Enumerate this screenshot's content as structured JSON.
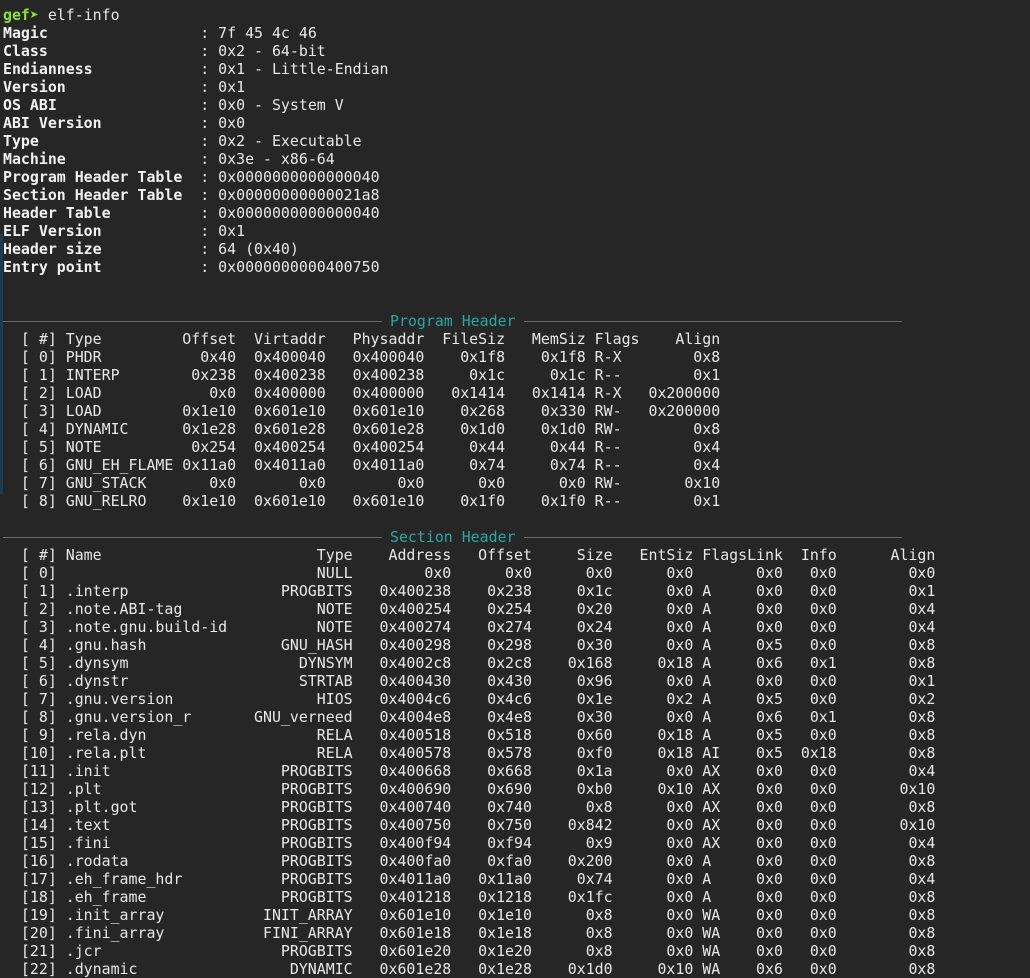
{
  "prompt": {
    "symbol": "gef➤",
    "command": "elf-info"
  },
  "elf_header": [
    {
      "key": "Magic",
      "value": "7f 45 4c 46"
    },
    {
      "key": "Class",
      "value": "0x2 - 64-bit"
    },
    {
      "key": "Endianness",
      "value": "0x1 - Little-Endian"
    },
    {
      "key": "Version",
      "value": "0x1"
    },
    {
      "key": "OS ABI",
      "value": "0x0 - System V"
    },
    {
      "key": "ABI Version",
      "value": "0x0"
    },
    {
      "key": "Type",
      "value": "0x2 - Executable"
    },
    {
      "key": "Machine",
      "value": "0x3e - x86-64"
    },
    {
      "key": "Program Header Table",
      "value": "0x0000000000000040"
    },
    {
      "key": "Section Header Table",
      "value": "0x00000000000021a8"
    },
    {
      "key": "Header Table",
      "value": "0x0000000000000040"
    },
    {
      "key": "ELF Version",
      "value": "0x1"
    },
    {
      "key": "Header size",
      "value": "64 (0x40)"
    },
    {
      "key": "Entry point",
      "value": "0x0000000000400750"
    }
  ],
  "program_header": {
    "title": "Program Header",
    "columns": [
      "[ #]",
      "Type",
      "Offset",
      "Virtaddr",
      "Physaddr",
      "FileSiz",
      "MemSiz",
      "Flags",
      "Align"
    ],
    "rows": [
      [
        "0",
        "PHDR",
        "0x40",
        "0x400040",
        "0x400040",
        "0x1f8",
        "0x1f8",
        "R-X",
        "0x8"
      ],
      [
        "1",
        "INTERP",
        "0x238",
        "0x400238",
        "0x400238",
        "0x1c",
        "0x1c",
        "R--",
        "0x1"
      ],
      [
        "2",
        "LOAD",
        "0x0",
        "0x400000",
        "0x400000",
        "0x1414",
        "0x1414",
        "R-X",
        "0x200000"
      ],
      [
        "3",
        "LOAD",
        "0x1e10",
        "0x601e10",
        "0x601e10",
        "0x268",
        "0x330",
        "RW-",
        "0x200000"
      ],
      [
        "4",
        "DYNAMIC",
        "0x1e28",
        "0x601e28",
        "0x601e28",
        "0x1d0",
        "0x1d0",
        "RW-",
        "0x8"
      ],
      [
        "5",
        "NOTE",
        "0x254",
        "0x400254",
        "0x400254",
        "0x44",
        "0x44",
        "R--",
        "0x4"
      ],
      [
        "6",
        "GNU_EH_FLAME",
        "0x11a0",
        "0x4011a0",
        "0x4011a0",
        "0x74",
        "0x74",
        "R--",
        "0x4"
      ],
      [
        "7",
        "GNU_STACK",
        "0x0",
        "0x0",
        "0x0",
        "0x0",
        "0x0",
        "RW-",
        "0x10"
      ],
      [
        "8",
        "GNU_RELRO",
        "0x1e10",
        "0x601e10",
        "0x601e10",
        "0x1f0",
        "0x1f0",
        "R--",
        "0x1"
      ]
    ]
  },
  "section_header": {
    "title": "Section Header",
    "columns": [
      "[ #]",
      "Name",
      "Type",
      "Address",
      "Offset",
      "Size",
      "EntSiz",
      "Flags",
      "Link",
      "Info",
      "Align"
    ],
    "rows": [
      [
        "0",
        "",
        "NULL",
        "0x0",
        "0x0",
        "0x0",
        "0x0",
        "",
        "0x0",
        "0x0",
        "0x0"
      ],
      [
        "1",
        ".interp",
        "PROGBITS",
        "0x400238",
        "0x238",
        "0x1c",
        "0x0",
        "A",
        "0x0",
        "0x0",
        "0x1"
      ],
      [
        "2",
        ".note.ABI-tag",
        "NOTE",
        "0x400254",
        "0x254",
        "0x20",
        "0x0",
        "A",
        "0x0",
        "0x0",
        "0x4"
      ],
      [
        "3",
        ".note.gnu.build-id",
        "NOTE",
        "0x400274",
        "0x274",
        "0x24",
        "0x0",
        "A",
        "0x0",
        "0x0",
        "0x4"
      ],
      [
        "4",
        ".gnu.hash",
        "GNU_HASH",
        "0x400298",
        "0x298",
        "0x30",
        "0x0",
        "A",
        "0x5",
        "0x0",
        "0x8"
      ],
      [
        "5",
        ".dynsym",
        "DYNSYM",
        "0x4002c8",
        "0x2c8",
        "0x168",
        "0x18",
        "A",
        "0x6",
        "0x1",
        "0x8"
      ],
      [
        "6",
        ".dynstr",
        "STRTAB",
        "0x400430",
        "0x430",
        "0x96",
        "0x0",
        "A",
        "0x0",
        "0x0",
        "0x1"
      ],
      [
        "7",
        ".gnu.version",
        "HIOS",
        "0x4004c6",
        "0x4c6",
        "0x1e",
        "0x2",
        "A",
        "0x5",
        "0x0",
        "0x2"
      ],
      [
        "8",
        ".gnu.version_r",
        "GNU_verneed",
        "0x4004e8",
        "0x4e8",
        "0x30",
        "0x0",
        "A",
        "0x6",
        "0x1",
        "0x8"
      ],
      [
        "9",
        ".rela.dyn",
        "RELA",
        "0x400518",
        "0x518",
        "0x60",
        "0x18",
        "A",
        "0x5",
        "0x0",
        "0x8"
      ],
      [
        "10",
        ".rela.plt",
        "RELA",
        "0x400578",
        "0x578",
        "0xf0",
        "0x18",
        "AI",
        "0x5",
        "0x18",
        "0x8"
      ],
      [
        "11",
        ".init",
        "PROGBITS",
        "0x400668",
        "0x668",
        "0x1a",
        "0x0",
        "AX",
        "0x0",
        "0x0",
        "0x4"
      ],
      [
        "12",
        ".plt",
        "PROGBITS",
        "0x400690",
        "0x690",
        "0xb0",
        "0x10",
        "AX",
        "0x0",
        "0x0",
        "0x10"
      ],
      [
        "13",
        ".plt.got",
        "PROGBITS",
        "0x400740",
        "0x740",
        "0x8",
        "0x0",
        "AX",
        "0x0",
        "0x0",
        "0x8"
      ],
      [
        "14",
        ".text",
        "PROGBITS",
        "0x400750",
        "0x750",
        "0x842",
        "0x0",
        "AX",
        "0x0",
        "0x0",
        "0x10"
      ],
      [
        "15",
        ".fini",
        "PROGBITS",
        "0x400f94",
        "0xf94",
        "0x9",
        "0x0",
        "AX",
        "0x0",
        "0x0",
        "0x4"
      ],
      [
        "16",
        ".rodata",
        "PROGBITS",
        "0x400fa0",
        "0xfa0",
        "0x200",
        "0x0",
        "A",
        "0x0",
        "0x0",
        "0x8"
      ],
      [
        "17",
        ".eh_frame_hdr",
        "PROGBITS",
        "0x4011a0",
        "0x11a0",
        "0x74",
        "0x0",
        "A",
        "0x0",
        "0x0",
        "0x4"
      ],
      [
        "18",
        ".eh_frame",
        "PROGBITS",
        "0x401218",
        "0x1218",
        "0x1fc",
        "0x0",
        "A",
        "0x0",
        "0x0",
        "0x8"
      ],
      [
        "19",
        ".init_array",
        "INIT_ARRAY",
        "0x601e10",
        "0x1e10",
        "0x8",
        "0x0",
        "WA",
        "0x0",
        "0x0",
        "0x8"
      ],
      [
        "20",
        ".fini_array",
        "FINI_ARRAY",
        "0x601e18",
        "0x1e18",
        "0x8",
        "0x0",
        "WA",
        "0x0",
        "0x0",
        "0x8"
      ],
      [
        "21",
        ".jcr",
        "PROGBITS",
        "0x601e20",
        "0x1e20",
        "0x8",
        "0x0",
        "WA",
        "0x0",
        "0x0",
        "0x8"
      ],
      [
        "22",
        ".dynamic",
        "DYNAMIC",
        "0x601e28",
        "0x1e28",
        "0x1d0",
        "0x10",
        "WA",
        "0x6",
        "0x0",
        "0x8"
      ]
    ]
  },
  "colors": {
    "background": "#262626",
    "text": "#e8e8e8",
    "prompt": "#8ae234",
    "section_title": "#2aa6a6",
    "rule": "#6b6b6b"
  }
}
